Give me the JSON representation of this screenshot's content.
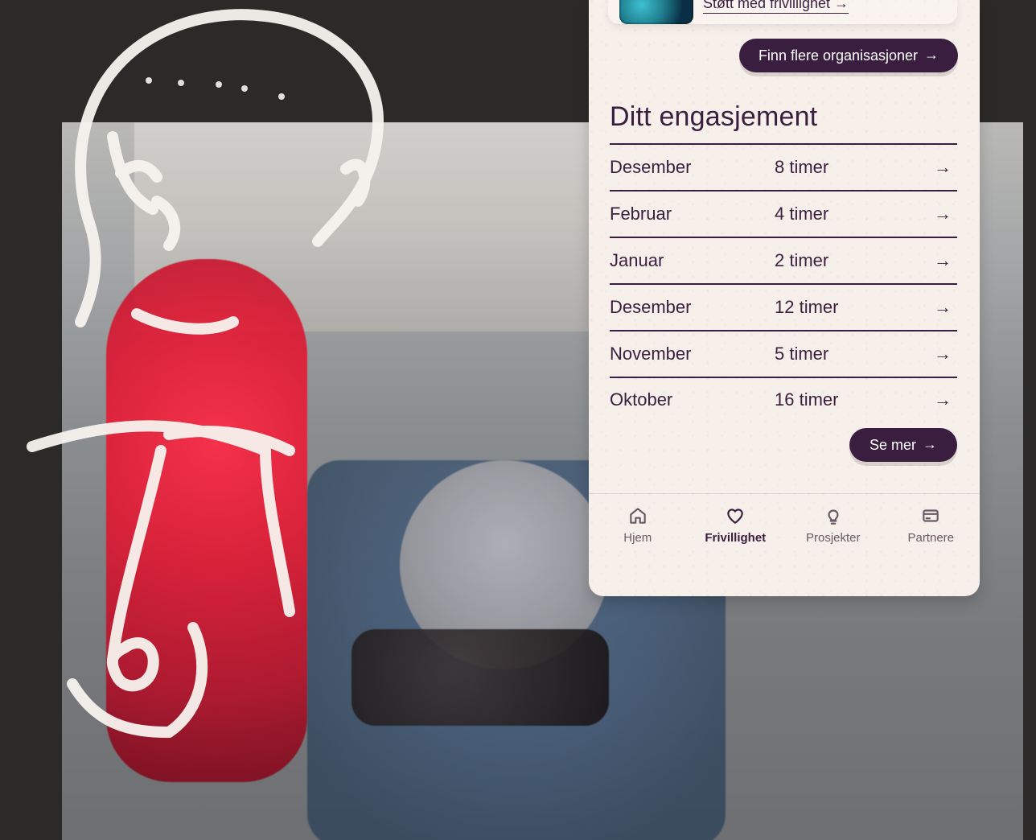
{
  "top_card": {
    "link_text": "Støtt med frivillighet →"
  },
  "buttons": {
    "find_more": "Finn flere organisasjoner",
    "see_more": "Se mer"
  },
  "section": {
    "title": "Ditt engasjement"
  },
  "engagement": [
    {
      "month": "Desember",
      "hours": "8 timer"
    },
    {
      "month": "Februar",
      "hours": "4 timer"
    },
    {
      "month": "Januar",
      "hours": "2 timer"
    },
    {
      "month": "Desember",
      "hours": "12 timer"
    },
    {
      "month": "November",
      "hours": "5 timer"
    },
    {
      "month": "Oktober",
      "hours": "16 timer"
    }
  ],
  "bottom_nav": {
    "items": [
      {
        "label": "Hjem",
        "icon": "home-icon"
      },
      {
        "label": "Frivillighet",
        "icon": "heart-icon"
      },
      {
        "label": "Prosjekter",
        "icon": "lightbulb-icon"
      },
      {
        "label": "Partnere",
        "icon": "card-icon"
      }
    ],
    "active_index": 1
  },
  "colors": {
    "primary": "#3a1e3f",
    "panel": "#f7efe9"
  }
}
